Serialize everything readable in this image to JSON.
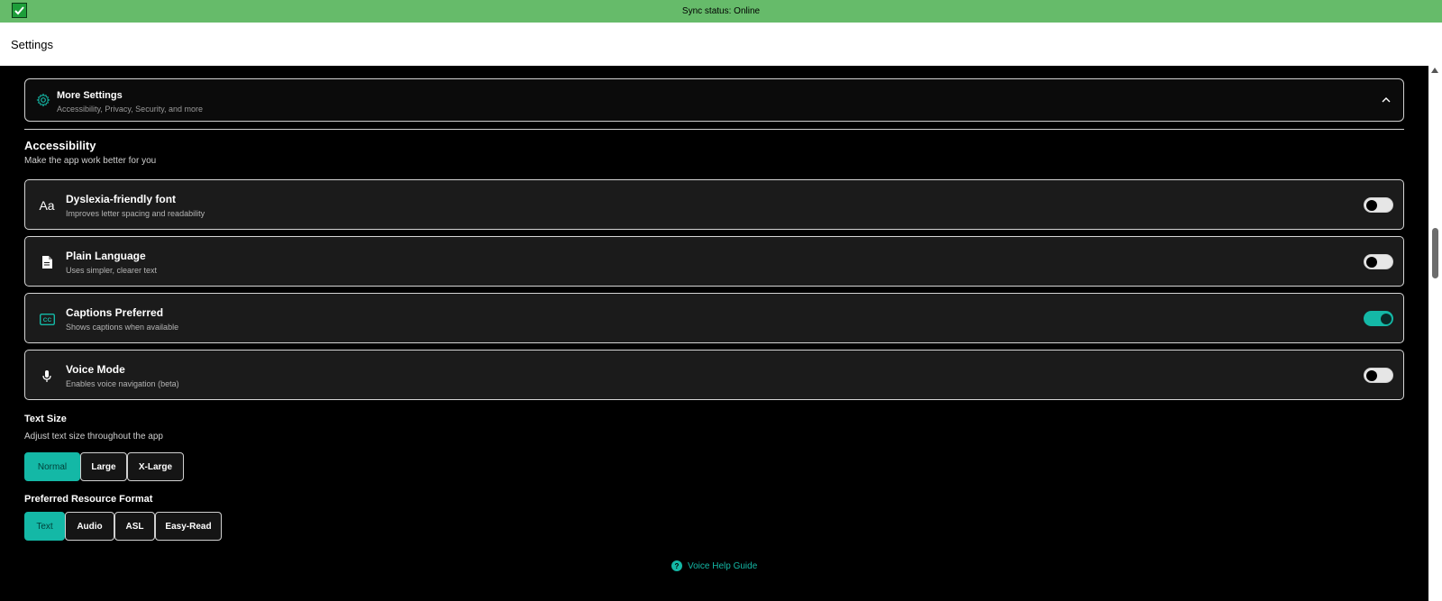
{
  "sync_bar": {
    "text": "Sync status: Online",
    "color": "#66bb6a"
  },
  "header": {
    "title": "Settings"
  },
  "more_settings": {
    "title": "More Settings",
    "subtitle": "Accessibility, Privacy, Security, and more",
    "icon": "gear-icon",
    "expanded": true
  },
  "accessibility": {
    "title": "Accessibility",
    "subtitle": "Make the app work better for you",
    "items": [
      {
        "title": "Dyslexia-friendly font",
        "subtitle": "Improves letter spacing and readability",
        "icon": "font-icon",
        "enabled": false
      },
      {
        "title": "Plain Language",
        "subtitle": "Uses simpler, clearer text",
        "icon": "document-icon",
        "enabled": false
      },
      {
        "title": "Captions Preferred",
        "subtitle": "Shows captions when available",
        "icon": "captions-icon",
        "enabled": true
      },
      {
        "title": "Voice Mode",
        "subtitle": "Enables voice navigation (beta)",
        "icon": "microphone-icon",
        "enabled": false
      }
    ]
  },
  "text_size": {
    "title": "Text Size",
    "subtitle": "Adjust text size throughout the app",
    "options": [
      "Normal",
      "Large",
      "X-Large"
    ],
    "selected": "Normal"
  },
  "resource_format": {
    "title": "Preferred Resource Format",
    "options": [
      "Text",
      "Audio",
      "ASL",
      "Easy-Read"
    ],
    "selected": "Text"
  },
  "help_link": {
    "label": "Voice Help Guide",
    "icon": "help-circle-icon"
  },
  "colors": {
    "accent": "#14b8a6",
    "background": "#000000",
    "card": "#1b1b1b"
  }
}
